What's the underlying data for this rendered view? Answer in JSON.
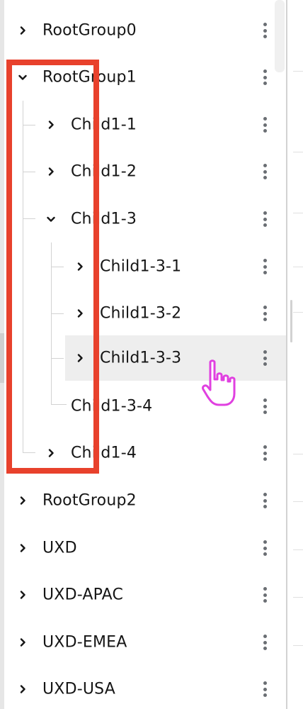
{
  "tree": {
    "items": [
      {
        "label": "RootGroup0",
        "expanded": false
      },
      {
        "label": "RootGroup1",
        "expanded": true
      },
      {
        "label": "Child1-1",
        "expanded": false
      },
      {
        "label": "Child1-2",
        "expanded": false
      },
      {
        "label": "Child1-3",
        "expanded": true
      },
      {
        "label": "Child1-3-1",
        "expanded": false
      },
      {
        "label": "Child1-3-2",
        "expanded": false
      },
      {
        "label": "Child1-3-3",
        "expanded": false,
        "hovered": true
      },
      {
        "label": "Child1-3-4",
        "leaf": true
      },
      {
        "label": "Child1-4",
        "expanded": false
      },
      {
        "label": "RootGroup2",
        "expanded": false
      },
      {
        "label": "UXD",
        "expanded": false
      },
      {
        "label": "UXD-APAC",
        "expanded": false
      },
      {
        "label": "UXD-EMEA",
        "expanded": false
      },
      {
        "label": "UXD-USA",
        "expanded": false
      }
    ]
  },
  "icons": {
    "collapsed": "chevron-right-icon",
    "expanded": "chevron-down-icon",
    "actions": "kebab-menu-icon",
    "pointer": "hand-pointer-icon"
  },
  "colors": {
    "text": "#151515",
    "kebab": "#6a6e73",
    "guide": "#d2d2d2",
    "hover": "#eeeeee",
    "highlight": "#e8412c",
    "cursor": "#e040e0"
  }
}
